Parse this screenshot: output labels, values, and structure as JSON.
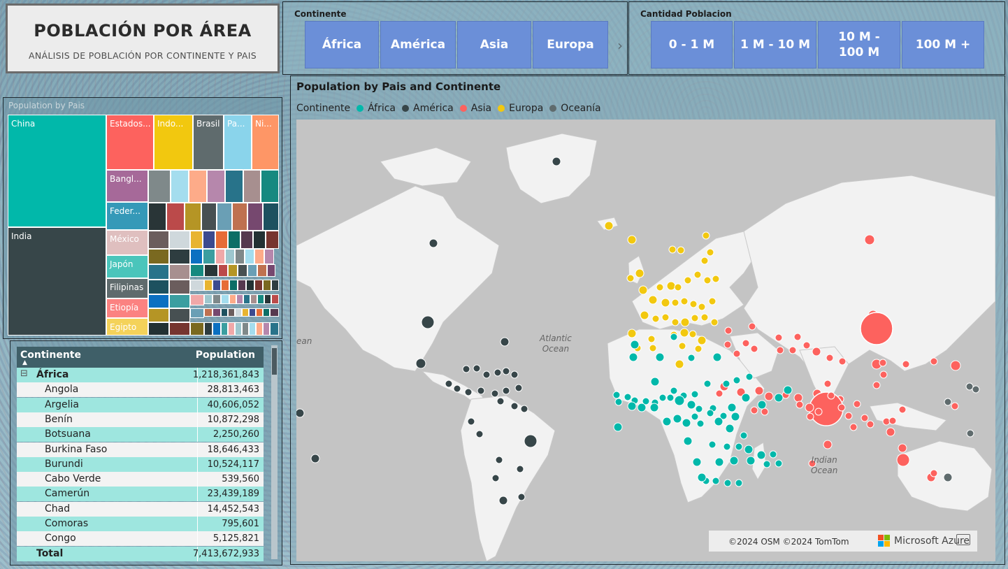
{
  "title_card": {
    "title": "POBLACIÓN POR ÁREA",
    "subtitle": "ANÁLISIS DE POBLACIÓN POR CONTINENTE Y PAIS"
  },
  "continent_slicer": {
    "header": "Continente",
    "buttons": [
      "África",
      "América",
      "Asia",
      "Europa"
    ]
  },
  "population_slicer": {
    "header": "Cantidad Poblacion",
    "buttons": [
      "0 - 1 M",
      "1 M - 10 M",
      "10 M - 100 M",
      "100 M +"
    ]
  },
  "treemap": {
    "header": "Population by Pais",
    "labels": [
      "China",
      "India",
      "Estados...",
      "Indo...",
      "Brasil",
      "Pa...",
      "Ni...",
      "Bangl...",
      "Feder...",
      "México",
      "Japón",
      "Filipinas",
      "Etiopía",
      "Egipto"
    ]
  },
  "table": {
    "col1": "Continente",
    "col2": "Population",
    "group": {
      "name": "África",
      "value": "1,218,361,843"
    },
    "rows": [
      {
        "name": "Angola",
        "value": "28,813,463"
      },
      {
        "name": "Argelia",
        "value": "40,606,052"
      },
      {
        "name": "Benín",
        "value": "10,872,298"
      },
      {
        "name": "Botsuana",
        "value": "2,250,260"
      },
      {
        "name": "Burkina Faso",
        "value": "18,646,433"
      },
      {
        "name": "Burundi",
        "value": "10,524,117"
      },
      {
        "name": "Cabo Verde",
        "value": "539,560"
      },
      {
        "name": "Camerún",
        "value": "23,439,189"
      },
      {
        "name": "Chad",
        "value": "14,452,543"
      },
      {
        "name": "Comoras",
        "value": "795,601"
      },
      {
        "name": "Congo",
        "value": "5,125,821"
      }
    ],
    "total": {
      "name": "Total",
      "value": "7,413,672,933"
    }
  },
  "map": {
    "title": "Population by Pais and Continente",
    "legend_title": "Continente",
    "legend": [
      {
        "name": "África",
        "color": "#01b8aa"
      },
      {
        "name": "América",
        "color": "#374649"
      },
      {
        "name": "Asia",
        "color": "#fd625e"
      },
      {
        "name": "Europa",
        "color": "#f2c80f"
      },
      {
        "name": "Oceanía",
        "color": "#5f6b6d"
      }
    ],
    "oceans": {
      "atlantic": "Atlantic\nOcean",
      "indian": "Indian\nOcean",
      "partial": "ean"
    },
    "attribution": "©2024 OSM ©2024 TomTom",
    "brand": "Microsoft Azure"
  }
}
